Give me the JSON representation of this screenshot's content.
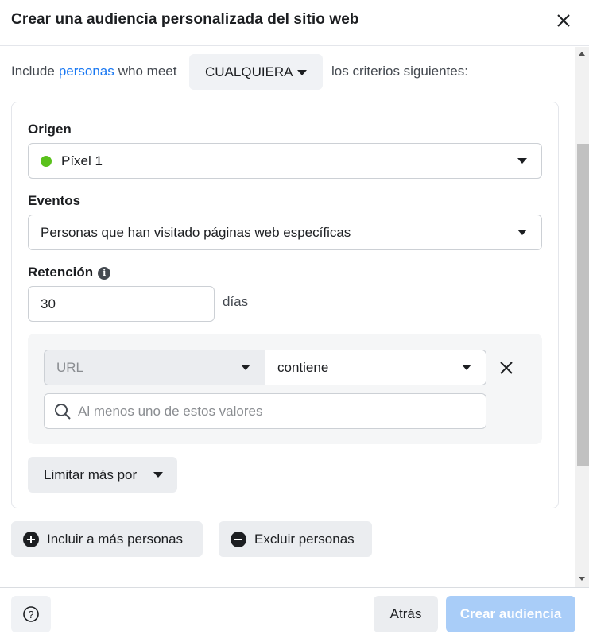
{
  "dialog": {
    "title": "Crear una audiencia personalizada del sitio web"
  },
  "include_row": {
    "prefix": "Include",
    "link_text": "personas",
    "middle": "who meet",
    "match_select": "CUALQUIERA",
    "suffix": "los criterios siguientes:"
  },
  "source": {
    "label": "Origen",
    "value": "Píxel 1",
    "status_color": "#5ac11c"
  },
  "events": {
    "label": "Eventos",
    "value": "Personas que han visitado páginas web específicas"
  },
  "retention": {
    "label": "Retención",
    "value": "30",
    "unit": "días",
    "info_icon": "info-icon"
  },
  "rule": {
    "field": "URL",
    "operator": "contiene",
    "value_placeholder": "Al menos uno de estos valores"
  },
  "refine": {
    "label": "Limitar más por"
  },
  "actions": {
    "include_more": "Incluir a más personas",
    "exclude": "Excluir personas"
  },
  "footer": {
    "back": "Atrás",
    "create": "Crear audiencia",
    "help_icon": "question-icon"
  },
  "colors": {
    "link": "#1877f2",
    "primary_disabled": "#a9cdf8"
  }
}
